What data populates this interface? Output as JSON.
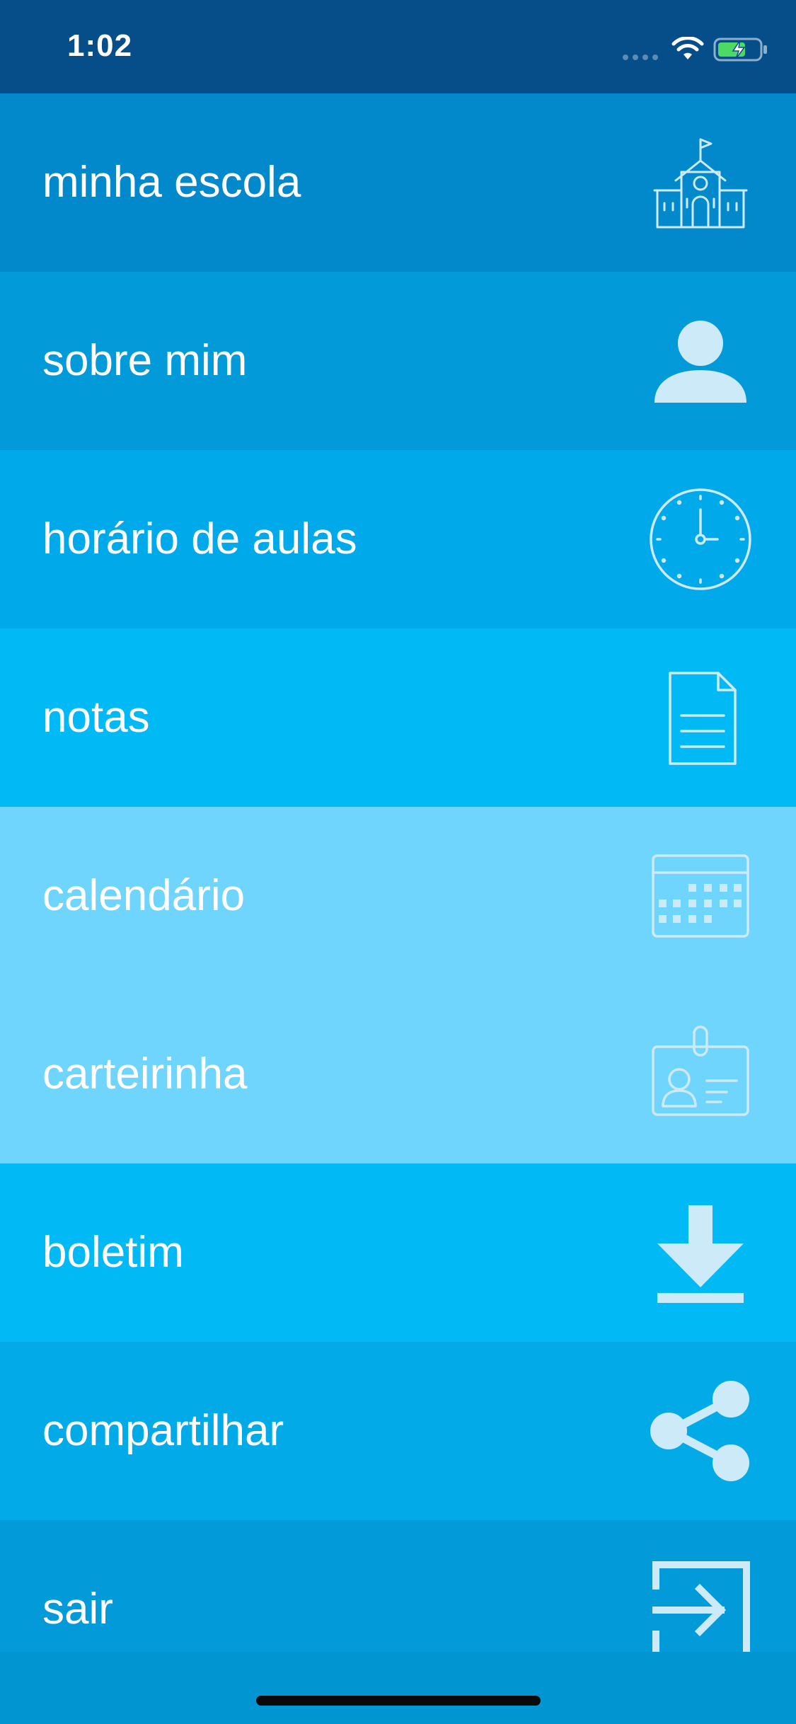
{
  "status_bar": {
    "time": "1:02",
    "signal_icon": "signal-dots-icon",
    "wifi_icon": "wifi-icon",
    "battery_icon": "battery-charging-icon",
    "battery_color": "#4cd964"
  },
  "menu": {
    "items": [
      {
        "label": "minha escola",
        "icon": "school-icon",
        "background": "#0289cb"
      },
      {
        "label": "sobre mim",
        "icon": "person-icon",
        "background": "#029ad9"
      },
      {
        "label": "horário de aulas",
        "icon": "clock-icon",
        "background": "#00a9e9"
      },
      {
        "label": "notas",
        "icon": "document-icon",
        "background": "#01b9f5"
      },
      {
        "label": "calendário",
        "icon": "calendar-icon",
        "background": "#6fd5fd"
      },
      {
        "label": "carteirinha",
        "icon": "id-card-icon",
        "background": "#6fd5fd"
      },
      {
        "label": "boletim",
        "icon": "download-icon",
        "background": "#01b9f5"
      },
      {
        "label": "compartilhar",
        "icon": "share-icon",
        "background": "#02aae8"
      },
      {
        "label": "sair",
        "icon": "exit-icon",
        "background": "#029ad9"
      }
    ]
  },
  "colors": {
    "status_bar_bg": "#064e8a",
    "icon_stroke": "#cdeaf8",
    "text": "#ffffff"
  }
}
